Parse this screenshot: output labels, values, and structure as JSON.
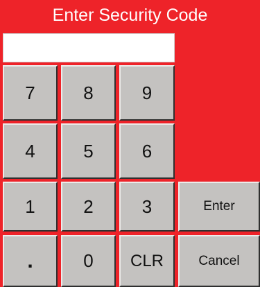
{
  "dialog": {
    "title": "Enter Security Code",
    "code_value": ""
  },
  "keypad": {
    "k7": "7",
    "k8": "8",
    "k9": "9",
    "k4": "4",
    "k5": "5",
    "k6": "6",
    "k1": "1",
    "k2": "2",
    "k3": "3",
    "dot": ".",
    "k0": "0",
    "clear": "CLR"
  },
  "actions": {
    "enter": "Enter",
    "cancel": "Cancel"
  },
  "colors": {
    "background": "#ee2329",
    "key_face": "#c4c2c0",
    "title_text": "#ffffff"
  }
}
